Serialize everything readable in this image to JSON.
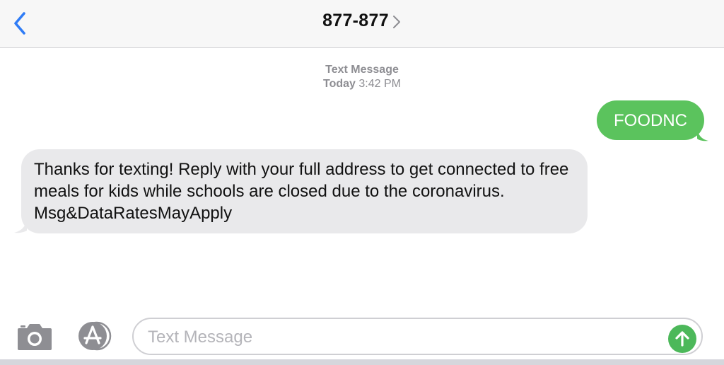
{
  "header": {
    "contact": "877-877"
  },
  "meta": {
    "type": "Text Message",
    "day": "Today",
    "time": "3:42 PM"
  },
  "messages": [
    {
      "direction": "sent",
      "text": "FOODNC"
    },
    {
      "direction": "received",
      "text": "Thanks for texting! Reply with your full address to get connected to free meals for kids while schools are closed due to the coronavirus. Msg&DataRatesMayApply"
    }
  ],
  "input": {
    "placeholder": "Text Message",
    "value": ""
  },
  "icons": {
    "back": "chevron-left-icon",
    "contact_details": "chevron-right-icon",
    "camera": "camera-icon",
    "apps": "app-store-icon",
    "send": "arrow-up-icon"
  },
  "colors": {
    "accent": "#2f7cf6",
    "sent_bubble": "#5bc35d",
    "received_bubble": "#e9e9eb",
    "send_button": "#4cb85a"
  }
}
